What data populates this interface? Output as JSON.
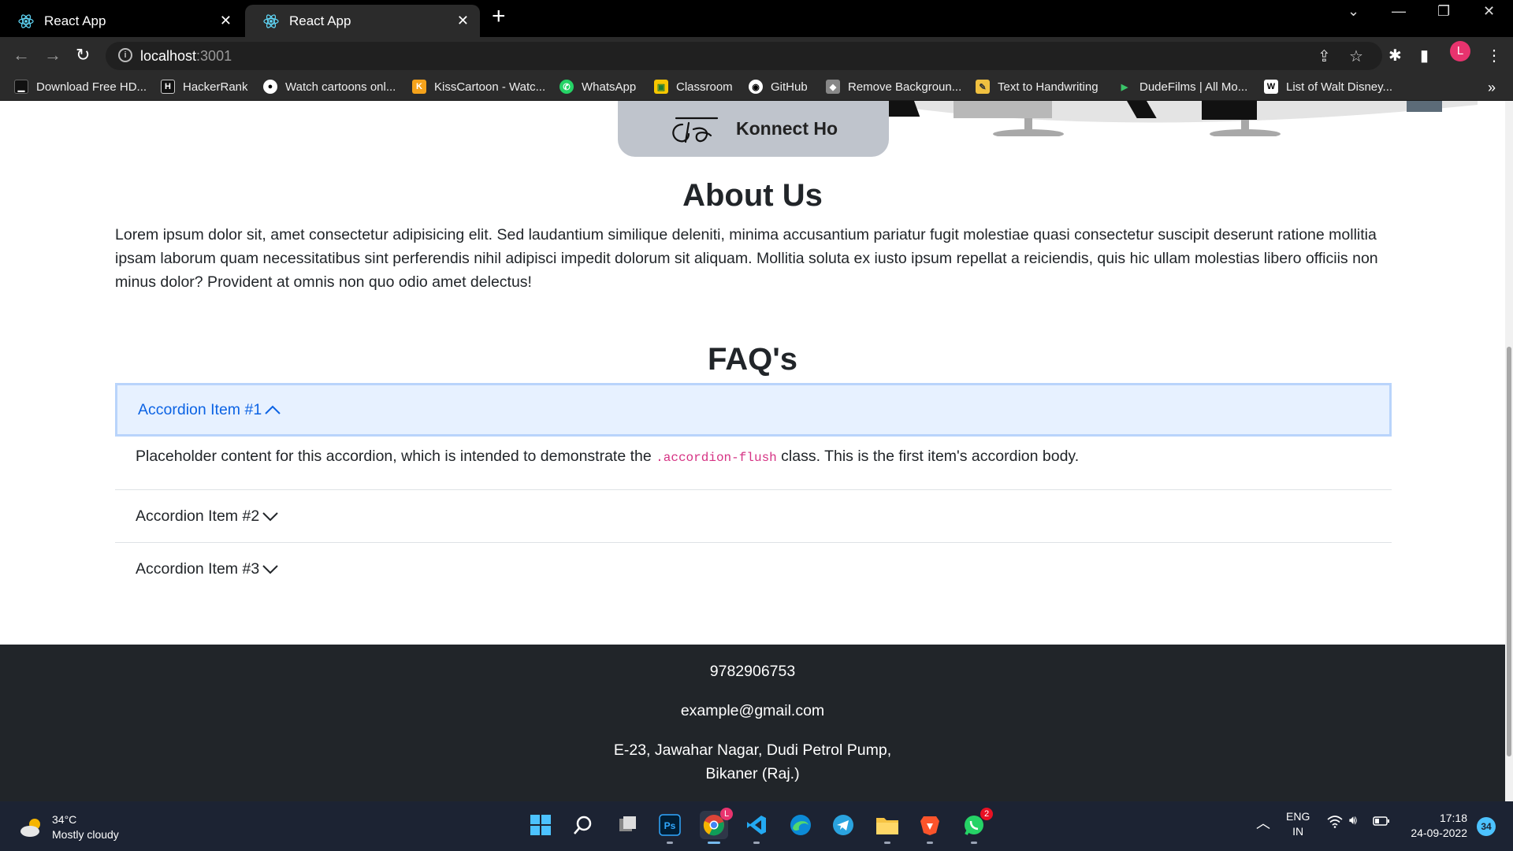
{
  "browser": {
    "tabs": [
      {
        "title": "React App",
        "active": false
      },
      {
        "title": "React App",
        "active": true
      }
    ],
    "url_host": "localhost",
    "url_port": ":3001",
    "profile_initial": "L",
    "bookmarks": [
      {
        "label": "Download Free HD...",
        "icon": "download-icon"
      },
      {
        "label": "HackerRank",
        "icon": "hackerrank-icon"
      },
      {
        "label": "Watch cartoons onl...",
        "icon": "globe-icon"
      },
      {
        "label": "KissCartoon - Watc...",
        "icon": "kisscartoon-icon"
      },
      {
        "label": "WhatsApp",
        "icon": "whatsapp-icon"
      },
      {
        "label": "Classroom",
        "icon": "classroom-icon"
      },
      {
        "label": "GitHub",
        "icon": "github-icon"
      },
      {
        "label": "Remove Backgroun...",
        "icon": "removebg-icon"
      },
      {
        "label": "Text to Handwriting",
        "icon": "pen-icon"
      },
      {
        "label": "DudeFilms | All Mo...",
        "icon": "play-icon"
      },
      {
        "label": "List of Walt Disney...",
        "icon": "wikipedia-icon"
      }
    ]
  },
  "brand": {
    "name": "Konnect Ho"
  },
  "about": {
    "title": "About Us",
    "text": "Lorem ipsum dolor sit, amet consectetur adipisicing elit. Sed laudantium similique deleniti, minima accusantium pariatur fugit molestiae quasi consectetur suscipit deserunt ratione mollitia ipsam laborum quam necessitatibus sint perferendis nihil adipisci impedit dolorum sit aliquam. Mollitia soluta ex iusto ipsum repellat a reiciendis, quis hic ullam molestias libero officiis non minus dolor? Provident at omnis non quo odio amet delectus!"
  },
  "faq": {
    "title": "FAQ's",
    "items": [
      {
        "label": "Accordion Item #1",
        "open": true
      },
      {
        "label": "Accordion Item #2",
        "open": false
      },
      {
        "label": "Accordion Item #3",
        "open": false
      }
    ],
    "body_before": "Placeholder content for this accordion, which is intended to demonstrate the ",
    "body_code": ".accordion-flush",
    "body_after": " class. This is the first item's accordion body."
  },
  "footer": {
    "phone": "9782906753",
    "email": "example@gmail.com",
    "address_line1": "E-23, Jawahar Nagar, Dudi Petrol Pump,",
    "address_line2": "Bikaner (Raj.)"
  },
  "taskbar": {
    "weather_temp": "34°C",
    "weather_desc": "Mostly cloudy",
    "lang": "ENG",
    "region": "IN",
    "time": "17:18",
    "date": "24-09-2022",
    "notification_count": "34",
    "chrome_badge": "L",
    "whatsapp_badge": "2"
  },
  "colors": {
    "accent_blue": "#0c63e4",
    "accordion_open_bg": "#e7f1ff",
    "footer_bg": "#212529",
    "code_pink": "#d63384"
  }
}
